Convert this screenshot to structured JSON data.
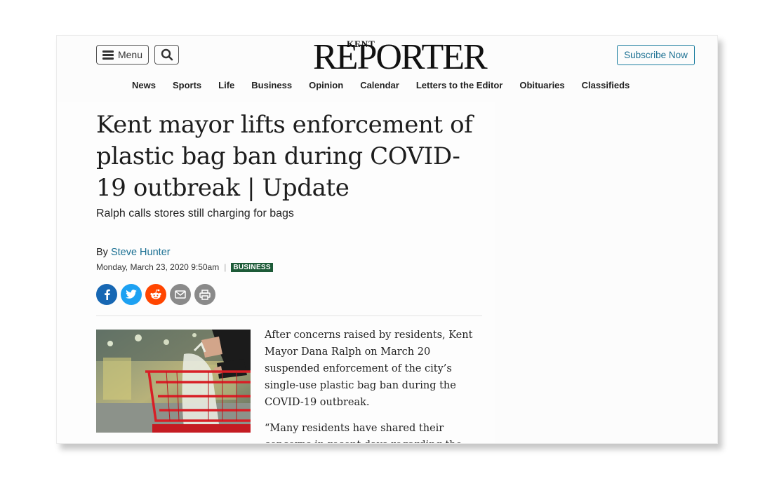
{
  "header": {
    "menu_label": "Menu",
    "logo_small": "KENT",
    "logo_big": "REPORTER",
    "subscribe_label": "Subscribe Now"
  },
  "nav": {
    "items": [
      "News",
      "Sports",
      "Life",
      "Business",
      "Opinion",
      "Calendar",
      "Letters to the Editor",
      "Obituaries",
      "Classifieds"
    ]
  },
  "article": {
    "headline": "Kent mayor lifts enforcement of plastic bag ban during COVID-19 outbreak | Update",
    "subhead": "Ralph calls stores still charging for bags",
    "by_prefix": "By",
    "author": "Steve Hunter",
    "date": "Monday, March 23, 2020 9:50am",
    "separator": "|",
    "category": "BUSINESS",
    "paragraphs": [
      "After concerns raised by residents, Kent Mayor Dana Ralph on March 20 suspended enforcement of the city’s single-use plastic bag ban during the COVID-19 outbreak.",
      "“Many residents have shared their concerns in recent days regarding the city"
    ]
  },
  "social": {
    "icons": [
      "facebook-icon",
      "twitter-icon",
      "reddit-icon",
      "email-icon",
      "print-icon"
    ],
    "colors": {
      "facebook": "#1767b3",
      "twitter": "#1da1f2",
      "reddit": "#ff4500",
      "email": "#8a8a8a",
      "print": "#8a8a8a"
    }
  },
  "colors": {
    "link": "#1a6f92",
    "badge": "#1d5b38",
    "subscribe_border": "#1e7fa0"
  }
}
